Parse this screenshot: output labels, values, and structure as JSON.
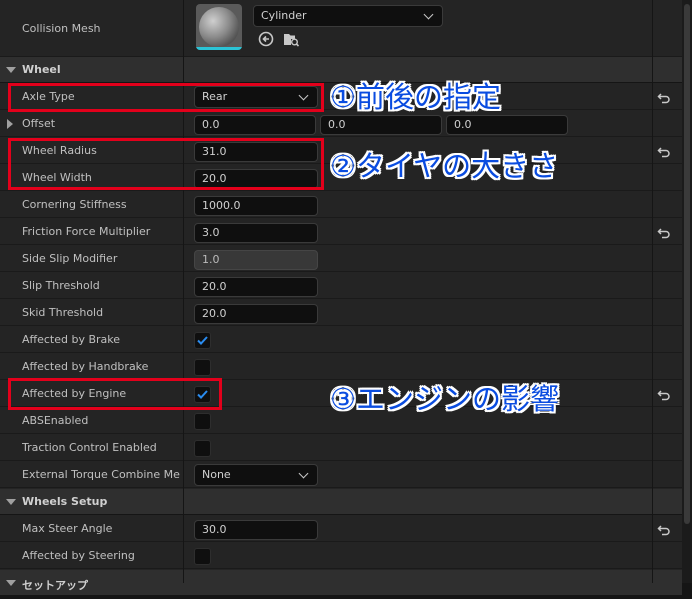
{
  "collision": {
    "label": "Collision Mesh",
    "mesh_value": "Cylinder",
    "use_icon": "arrow-left-circle-icon",
    "browse_icon": "folder-search-icon"
  },
  "categories": {
    "wheel": "Wheel",
    "wheels_setup": "Wheels Setup",
    "setup_partial": "セットアップ"
  },
  "props": {
    "axle_type": {
      "label": "Axle Type",
      "value": "Rear"
    },
    "offset": {
      "label": "Offset",
      "x": "0.0",
      "y": "0.0",
      "z": "0.0"
    },
    "wheel_radius": {
      "label": "Wheel Radius",
      "value": "31.0"
    },
    "wheel_width": {
      "label": "Wheel Width",
      "value": "20.0"
    },
    "cornering": {
      "label": "Cornering Stiffness",
      "value": "1000.0"
    },
    "friction": {
      "label": "Friction Force Multiplier",
      "value": "3.0"
    },
    "side_slip": {
      "label": "Side Slip Modifier",
      "value": "1.0"
    },
    "slip_threshold": {
      "label": "Slip Threshold",
      "value": "20.0"
    },
    "skid_threshold": {
      "label": "Skid Threshold",
      "value": "20.0"
    },
    "affected_brake": {
      "label": "Affected by Brake",
      "checked": true
    },
    "affected_handbrake": {
      "label": "Affected by Handbrake",
      "checked": false
    },
    "affected_engine": {
      "label": "Affected by Engine",
      "checked": true
    },
    "abs": {
      "label": "ABSEnabled",
      "checked": false
    },
    "traction": {
      "label": "Traction Control Enabled",
      "checked": false
    },
    "ext_torque": {
      "label": "External Torque Combine Met...",
      "value": "None"
    },
    "max_steer": {
      "label": "Max Steer Angle",
      "value": "30.0"
    },
    "affected_steering": {
      "label": "Affected by Steering",
      "checked": false
    }
  },
  "annotations": {
    "note1": "①前後の指定",
    "note2": "②タイヤの大きさ",
    "note3": "③エンジンの影響"
  },
  "colors": {
    "highlight": "#e3001b",
    "note_text": "#0a4ce0",
    "check": "#2a8cf0",
    "thumbnail_accent": "#2bc4d6"
  }
}
